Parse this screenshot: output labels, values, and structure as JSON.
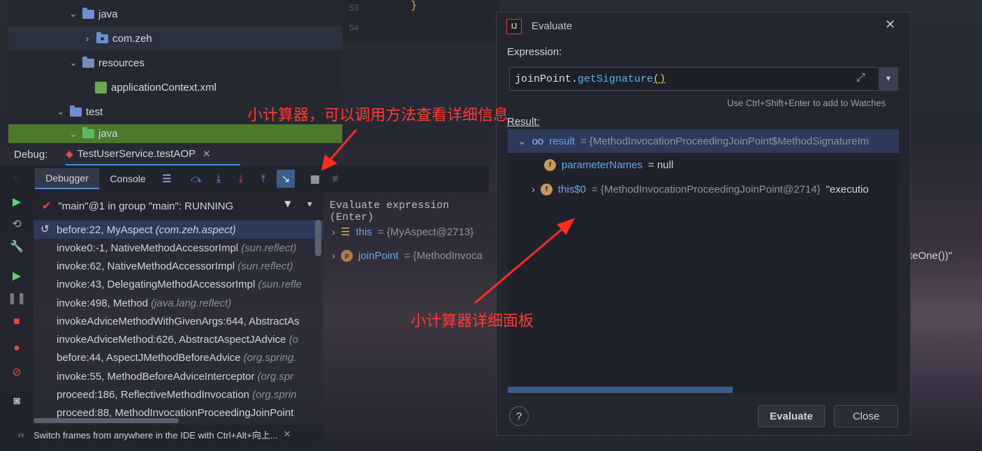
{
  "project_tree": {
    "items": [
      {
        "label": "java"
      },
      {
        "label": "com.zeh"
      },
      {
        "label": "resources"
      },
      {
        "label": "applicationContext.xml"
      },
      {
        "label": "test"
      },
      {
        "label": "java"
      }
    ]
  },
  "editor": {
    "line_numbers": [
      "53",
      "54"
    ],
    "code_brace": "}"
  },
  "debug": {
    "label": "Debug:",
    "session_tab": "TestUserService.testAOP",
    "tabs": [
      "Debugger",
      "Console"
    ],
    "thread": "\"main\"@1 in group \"main\": RUNNING",
    "evaluate_prompt": "Evaluate expression (Enter)",
    "frames": [
      {
        "method": "before:22, MyAspect",
        "pkg": "(com.zeh.aspect)"
      },
      {
        "method": "invoke0:-1, NativeMethodAccessorImpl",
        "pkg": "(sun.reflect)"
      },
      {
        "method": "invoke:62, NativeMethodAccessorImpl",
        "pkg": "(sun.reflect)"
      },
      {
        "method": "invoke:43, DelegatingMethodAccessorImpl",
        "pkg": "(sun.refle"
      },
      {
        "method": "invoke:498, Method",
        "pkg": "(java.lang.reflect)"
      },
      {
        "method": "invokeAdviceMethodWithGivenArgs:644, AbstractAs",
        "pkg": ""
      },
      {
        "method": "invokeAdviceMethod:626, AbstractAspectJAdvice",
        "pkg": "(o"
      },
      {
        "method": "before:44, AspectJMethodBeforeAdvice",
        "pkg": "(org.spring."
      },
      {
        "method": "invoke:55, MethodBeforeAdviceInterceptor",
        "pkg": "(org.spr"
      },
      {
        "method": "proceed:186, ReflectiveMethodInvocation",
        "pkg": "(org.sprin"
      },
      {
        "method": "proceed:88, MethodInvocationProceedingJoinPoint",
        "pkg": ""
      }
    ],
    "hint": "Switch frames from anywhere in the IDE with Ctrl+Alt+向上...",
    "variables": [
      {
        "name": "this",
        "value": "= {MyAspect@2713}"
      },
      {
        "name": "joinPoint",
        "value": "= {MethodInvoca"
      }
    ],
    "overflow_text": "teOne())\""
  },
  "dialog": {
    "title": "Evaluate",
    "expression_label": "Expression:",
    "expression_obj": "joinPoint.",
    "expression_call": "getSignature",
    "expression_parens": "()",
    "watch_hint": "Use Ctrl+Shift+Enter to add to Watches",
    "result_label": "Result:",
    "result": {
      "name": "result",
      "value": "= {MethodInvocationProceedingJoinPoint$MethodSignatureIm",
      "children": [
        {
          "name": "parameterNames",
          "value": "= null"
        },
        {
          "name": "this$0",
          "value": "= {MethodInvocationProceedingJoinPoint@2714}",
          "extra": "\"executio"
        }
      ]
    },
    "help": "?",
    "evaluate_button": "Evaluate",
    "close_button": "Close"
  },
  "annotations": {
    "top": "小计算器，可以调用方法查看详细信息",
    "bottom": "小计算器详细面板"
  },
  "colors": {
    "accent": "#4a8fe0",
    "annotation": "#ff3b30",
    "green_row": "#4c7a2a",
    "selected_row": "#2f3a5a"
  }
}
